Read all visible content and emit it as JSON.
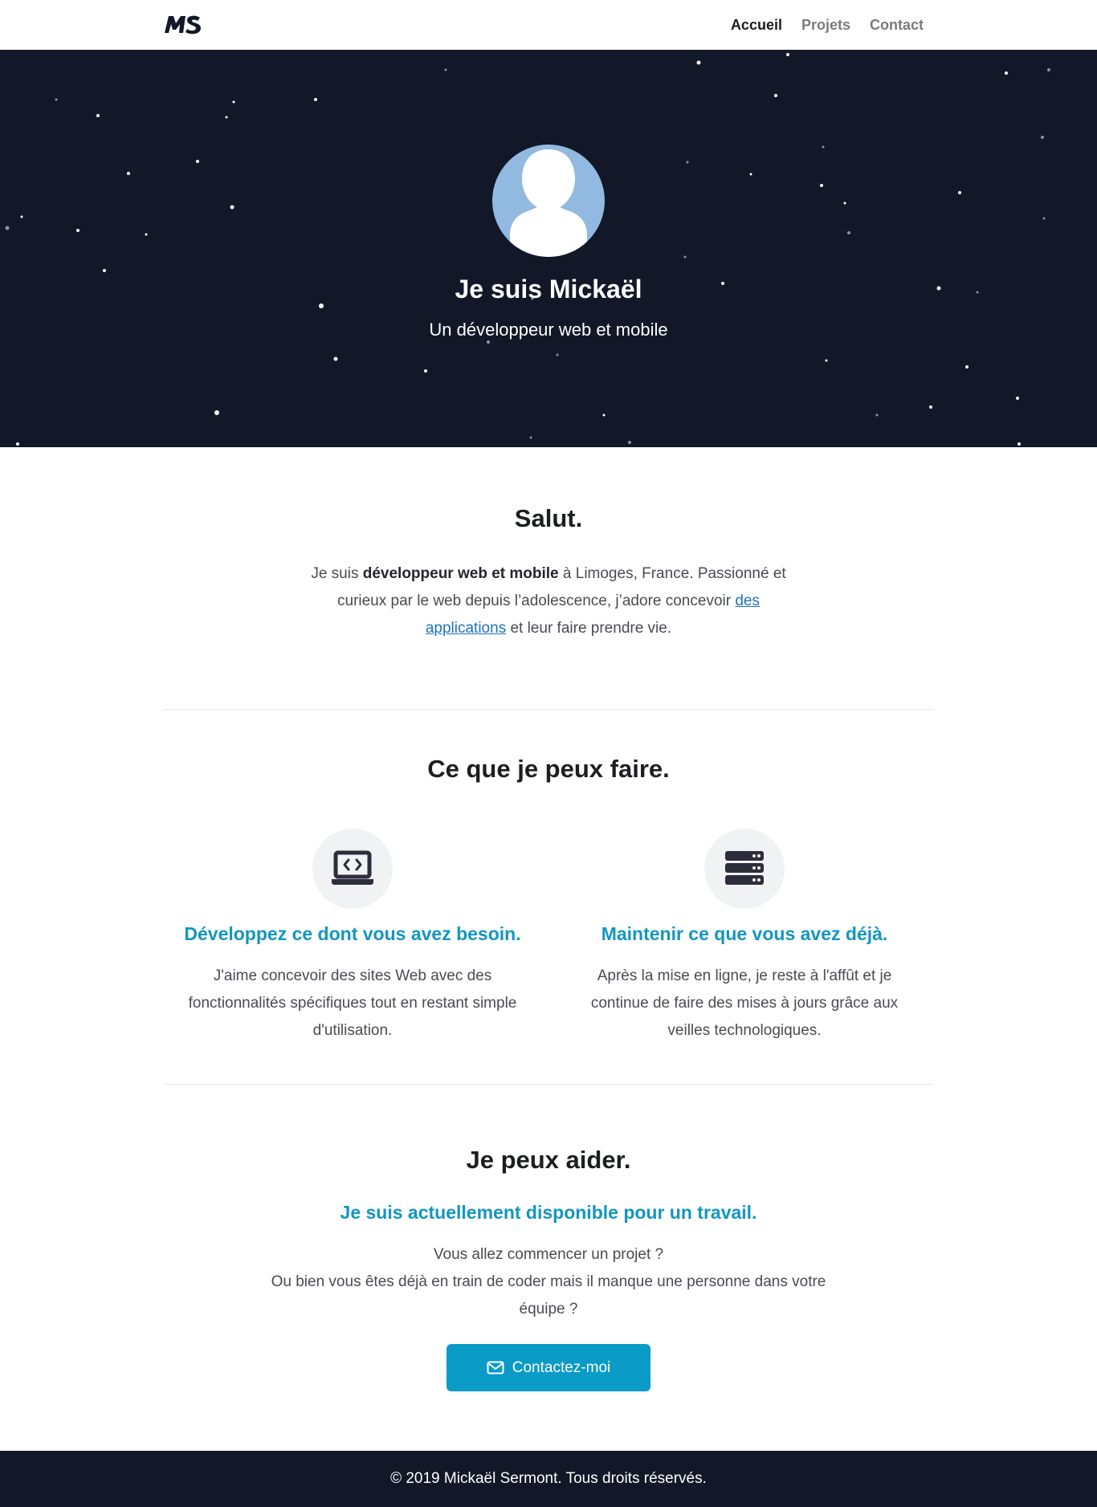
{
  "navbar": {
    "logo_text": "MS",
    "links": [
      {
        "label": "Accueil",
        "active": true
      },
      {
        "label": "Projets",
        "active": false
      },
      {
        "label": "Contact",
        "active": false
      }
    ]
  },
  "hero": {
    "avatar_icon": "user-silhouette-icon",
    "title": "Je suis Mickaël",
    "subtitle": "Un développeur web et mobile"
  },
  "about": {
    "title": "Salut.",
    "text_before": "Je suis ",
    "text_bold": "développeur web et mobile",
    "text_middle": " à Limoges, France. Passionné et curieux par le web depuis l’adolescence, j’adore concevoir ",
    "text_link": "des applications",
    "text_after": " et leur faire prendre vie."
  },
  "services": {
    "title": "Ce que je peux faire.",
    "items": [
      {
        "icon": "laptop-code-icon",
        "title": "Développez ce dont vous avez besoin.",
        "text": "J'aime concevoir des sites Web avec des fonctionnalités spécifiques tout en restant simple d'utilisation."
      },
      {
        "icon": "server-icon",
        "title": "Maintenir ce que vous avez déjà.",
        "text": "Après la mise en ligne, je reste à l'affût et je continue de faire des mises à jours grâce aux veilles technologiques."
      }
    ]
  },
  "cta": {
    "title": "Je peux aider.",
    "lead": "Je suis actuellement disponible pour un travail.",
    "line1": "Vous allez commencer un projet ?",
    "line2": "Ou bien vous êtes déjà en train de coder mais il manque une personne dans votre équipe ?",
    "button_icon": "envelope-icon",
    "button_label": "Contactez-moi"
  },
  "footer": {
    "text": "© 2019 Mickaël Sermont. Tous droits réservés."
  },
  "colors": {
    "hero_bg": "#121828",
    "accent": "#1396bf",
    "button": "#0a9bc6",
    "link": "#1d72c0",
    "avatar_bg": "#92bae0"
  }
}
